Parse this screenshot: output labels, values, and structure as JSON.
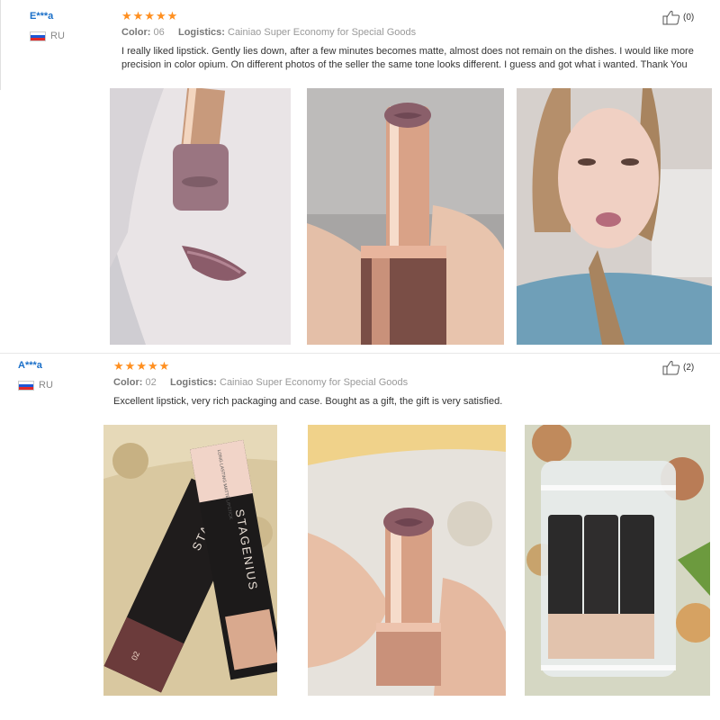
{
  "reviews": [
    {
      "user": "E***a",
      "country": "RU",
      "rating": 5,
      "color_label": "Color:",
      "color_value": "06",
      "logistics_label": "Logistics:",
      "logistics_value": "Cainiao Super Economy for Special Goods",
      "text": "I really liked lipstick. Gently lies down, after a few minutes becomes matte, almost does not remain on the dishes. I would like more precision in color opium. On different photos of the seller the same tone looks different. I guess and got what i wanted. Thank You",
      "likes": "(0)",
      "photos": [
        "lipstick swatch on hand",
        "lipstick held in hand",
        "woman wearing lipstick"
      ]
    },
    {
      "user": "A***a",
      "country": "RU",
      "rating": 5,
      "color_label": "Color:",
      "color_value": "02",
      "logistics_label": "Logistics:",
      "logistics_value": "Cainiao Super Economy for Special Goods",
      "text": "Excellent lipstick, very rich packaging and case. Bought as a gift, the gift is very satisfied.",
      "likes": "(2)",
      "photos": [
        "STAGENIUS lipstick boxes",
        "lipstick held in hand",
        "lipsticks in bubble packaging"
      ]
    }
  ],
  "photo_text": {
    "box_brand_1": "STAGENIUS",
    "box_brand_2": "STAGENIUS",
    "box_sub": "LONG LASTING MATTE LIPSTICK",
    "box_shade": "02"
  },
  "colors": {
    "star": "#ff8f1f",
    "username": "#1a6fc8"
  },
  "icons": [
    "thumbs-up-icon",
    "star-icon",
    "flag-ru-icon"
  ]
}
